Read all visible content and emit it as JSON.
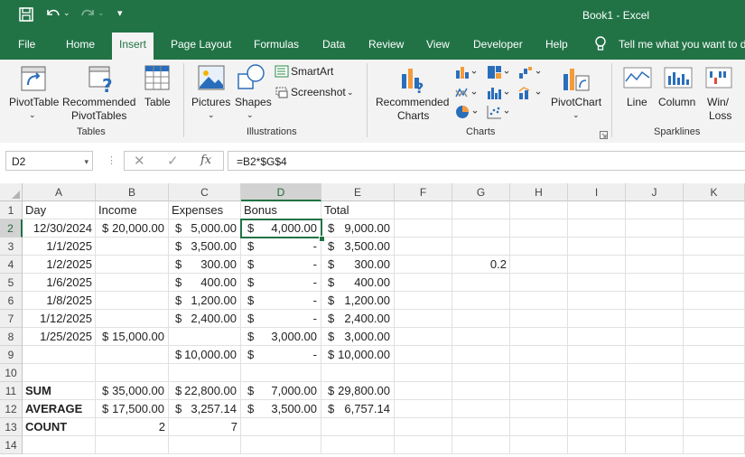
{
  "app": {
    "title": "Book1  -  Excel"
  },
  "tabs": [
    "File",
    "Home",
    "Insert",
    "Page Layout",
    "Formulas",
    "Data",
    "Review",
    "View",
    "Developer",
    "Help"
  ],
  "active_tab": "Insert",
  "tell_me": "Tell me what you want to do",
  "ribbon": {
    "tables": {
      "pivottable": "PivotTable",
      "recommended_pivottables_1": "Recommended",
      "recommended_pivottables_2": "PivotTables",
      "table": "Table",
      "group": "Tables"
    },
    "illustrations": {
      "pictures": "Pictures",
      "shapes": "Shapes",
      "smartart": "SmartArt",
      "screenshot": "Screenshot",
      "group": "Illustrations"
    },
    "charts": {
      "recommended_1": "Recommended",
      "recommended_2": "Charts",
      "pivotchart": "PivotChart",
      "group": "Charts"
    },
    "sparklines": {
      "line": "Line",
      "column": "Column",
      "winloss_1": "Win/",
      "winloss_2": "Loss",
      "group": "Sparklines"
    }
  },
  "formula_bar": {
    "name_box": "D2",
    "formula": "=B2*$G$4",
    "fx_label": "fx"
  },
  "columns": [
    "A",
    "B",
    "C",
    "D",
    "E",
    "F",
    "G",
    "H",
    "I",
    "J",
    "K"
  ],
  "rows": [
    "1",
    "2",
    "3",
    "4",
    "5",
    "6",
    "7",
    "8",
    "9",
    "10",
    "11",
    "12",
    "13",
    "14"
  ],
  "headers": {
    "day": "Day",
    "income": "Income",
    "expenses": "Expenses",
    "bonus": "Bonus",
    "total": "Total"
  },
  "data_rows": [
    {
      "day": "12/30/2024",
      "income": [
        "$",
        "20,000.00"
      ],
      "expenses": [
        "$",
        "5,000.00"
      ],
      "bonus": [
        "$",
        "4,000.00"
      ],
      "total": [
        "$",
        "9,000.00"
      ]
    },
    {
      "day": "1/1/2025",
      "income": null,
      "expenses": [
        "$",
        "3,500.00"
      ],
      "bonus": [
        "$",
        "-"
      ],
      "total": [
        "$",
        "3,500.00"
      ]
    },
    {
      "day": "1/2/2025",
      "income": null,
      "expenses": [
        "$",
        "300.00"
      ],
      "bonus": [
        "$",
        "-"
      ],
      "total": [
        "$",
        "300.00"
      ]
    },
    {
      "day": "1/6/2025",
      "income": null,
      "expenses": [
        "$",
        "400.00"
      ],
      "bonus": [
        "$",
        "-"
      ],
      "total": [
        "$",
        "400.00"
      ]
    },
    {
      "day": "1/8/2025",
      "income": null,
      "expenses": [
        "$",
        "1,200.00"
      ],
      "bonus": [
        "$",
        "-"
      ],
      "total": [
        "$",
        "1,200.00"
      ]
    },
    {
      "day": "1/12/2025",
      "income": null,
      "expenses": [
        "$",
        "2,400.00"
      ],
      "bonus": [
        "$",
        "-"
      ],
      "total": [
        "$",
        "2,400.00"
      ]
    },
    {
      "day": "1/25/2025",
      "income": [
        "$",
        "15,000.00"
      ],
      "expenses": null,
      "bonus": [
        "$",
        "3,000.00"
      ],
      "total": [
        "$",
        "3,000.00"
      ]
    },
    {
      "day": "",
      "income": null,
      "expenses": [
        "$",
        "10,000.00"
      ],
      "bonus": [
        "$",
        "-"
      ],
      "total": [
        "$",
        "10,000.00"
      ]
    }
  ],
  "g4_value": "0.2",
  "summary": [
    {
      "label": "SUM",
      "income": [
        "$",
        "35,000.00"
      ],
      "expenses": [
        "$",
        "22,800.00"
      ],
      "bonus": [
        "$",
        "7,000.00"
      ],
      "total": [
        "$",
        "29,800.00"
      ]
    },
    {
      "label": "AVERAGE",
      "income": [
        "$",
        "17,500.00"
      ],
      "expenses": [
        "$",
        "3,257.14"
      ],
      "bonus": [
        "$",
        "3,500.00"
      ],
      "total": [
        "$",
        "6,757.14"
      ]
    },
    {
      "label": "COUNT",
      "income_count": "2",
      "expenses_count": "7"
    }
  ],
  "colors": {
    "excel_green": "#217346"
  }
}
